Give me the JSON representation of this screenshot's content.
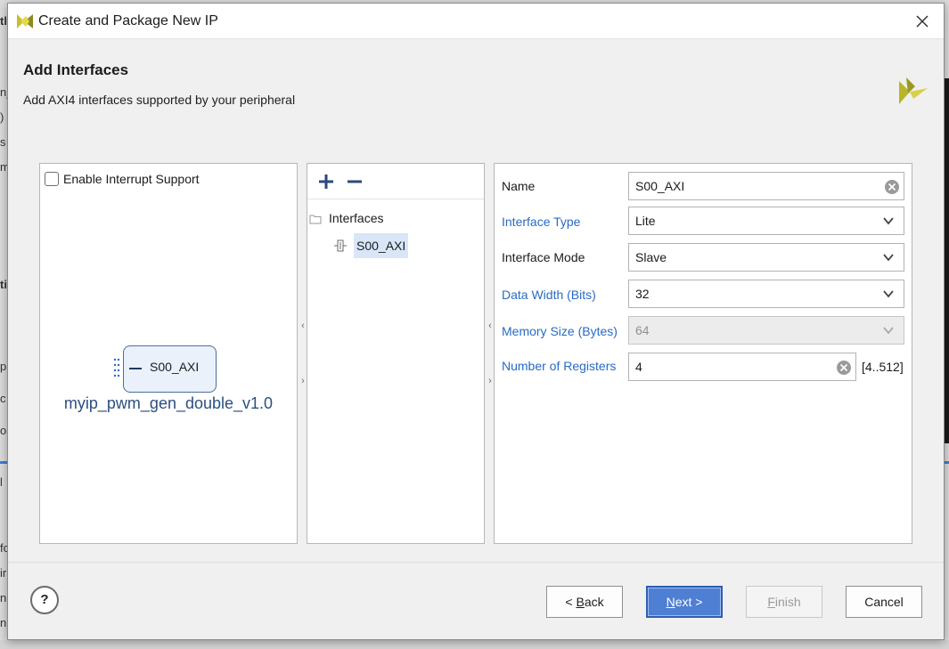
{
  "background": {
    "fragments": [
      "tl",
      "n_",
      ")",
      "s",
      "m",
      "ti",
      "p",
      "c",
      "op",
      "l",
      "fo",
      "ir",
      "ni",
      "nr"
    ]
  },
  "dialog": {
    "title": "Create and Package New IP",
    "header_title": "Add Interfaces",
    "header_subtitle": "Add AXI4 interfaces supported by your peripheral"
  },
  "left_panel": {
    "interrupt_label": "Enable Interrupt Support",
    "interrupt_checked": false,
    "port_label": "S00_AXI",
    "ip_name": "myip_pwm_gen_double_v1.0"
  },
  "mid_panel": {
    "add_icon": "plus-icon",
    "remove_icon": "minus-icon",
    "tree_root": "Interfaces",
    "tree_item": "S00_AXI"
  },
  "properties": {
    "name_label": "Name",
    "name_value": "S00_AXI",
    "interface_type_label": "Interface Type",
    "interface_type_value": "Lite",
    "interface_mode_label": "Interface Mode",
    "interface_mode_value": "Slave",
    "data_width_label": "Data Width (Bits)",
    "data_width_value": "32",
    "memory_size_label": "Memory Size (Bytes)",
    "memory_size_value": "64",
    "num_registers_label": "Number of Registers",
    "num_registers_value": "4",
    "num_registers_range": "[4..512]"
  },
  "footer": {
    "help_label": "?",
    "back_prefix": "< ",
    "back_key": "B",
    "back_rest": "ack",
    "next_key": "N",
    "next_rest": "ext >",
    "finish_key": "F",
    "finish_rest": "inish",
    "cancel_label": "Cancel"
  },
  "colors": {
    "accent_blue": "#2a6ac4",
    "primary_button": "#4f7fd3",
    "logo_yellow": "#c8c02a",
    "logo_olive": "#8a8a20"
  }
}
